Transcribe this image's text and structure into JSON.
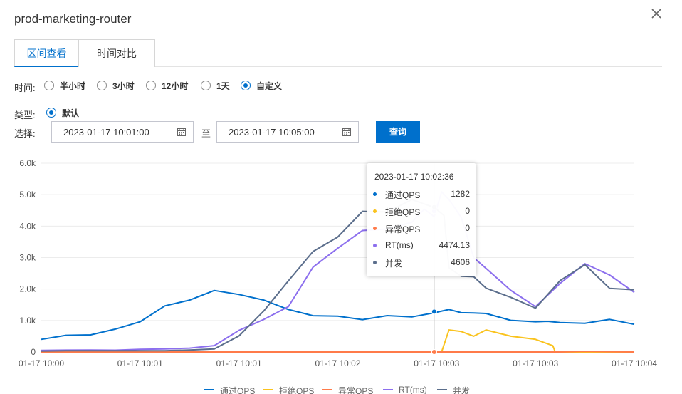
{
  "dialog": {
    "title": "prod-marketing-router"
  },
  "tabs": [
    {
      "label": "区间查看"
    },
    {
      "label": "时间对比"
    }
  ],
  "time_filter": {
    "label": "时间:",
    "options": [
      {
        "label": "半小时",
        "checked": false
      },
      {
        "label": "3小时",
        "checked": false
      },
      {
        "label": "12小时",
        "checked": false
      },
      {
        "label": "1天",
        "checked": false
      },
      {
        "label": "自定义",
        "checked": true
      }
    ]
  },
  "type_filter": {
    "label": "类型:",
    "options": [
      {
        "label": "默认",
        "checked": true
      }
    ]
  },
  "range": {
    "label": "选择:",
    "start": "2023-01-17 10:01:00",
    "separator": "至",
    "end": "2023-01-17 10:05:00",
    "query_label": "查询"
  },
  "tooltip": {
    "title": "2023-01-17 10:02:36",
    "rows": [
      {
        "name": "通过QPS",
        "value": "1282",
        "color": "#0070cc"
      },
      {
        "name": "拒绝QPS",
        "value": "0",
        "color": "#fac31e"
      },
      {
        "name": "异常QPS",
        "value": "0",
        "color": "#ff7b4a"
      },
      {
        "name": "RT(ms)",
        "value": "4474.13",
        "color": "#8c6fee"
      },
      {
        "name": "并发",
        "value": "4606",
        "color": "#5b6e8c"
      }
    ]
  },
  "chart_data": {
    "type": "line",
    "y_ticks": [
      "0",
      "1.0k",
      "2.0k",
      "3.0k",
      "4.0k",
      "5.0k",
      "6.0k"
    ],
    "x_ticks": [
      "01-17 10:00",
      "01-17 10:01",
      "01-17 10:01",
      "01-17 10:02",
      "01-17 10:03",
      "01-17 10:03",
      "01-17 10:04"
    ],
    "ylim": [
      0,
      6000
    ],
    "x_range": [
      0,
      240
    ],
    "hover_x": 159,
    "series": [
      {
        "name": "通过QPS",
        "color": "#0070cc",
        "x": [
          0,
          10,
          20,
          30,
          40,
          50,
          60,
          70,
          80,
          90,
          100,
          110,
          120,
          130,
          140,
          150,
          159,
          165,
          170,
          175,
          180,
          190,
          200,
          205,
          210,
          220,
          230,
          240
        ],
        "values": [
          400,
          520,
          560,
          700,
          1000,
          1420,
          1680,
          1950,
          1800,
          1700,
          1300,
          1200,
          1100,
          1050,
          1150,
          1100,
          1282,
          1300,
          1300,
          1200,
          1250,
          1000,
          950,
          1000,
          900,
          950,
          1000,
          900
        ]
      },
      {
        "name": "拒绝QPS",
        "color": "#fac31e",
        "x": [
          0,
          10,
          20,
          30,
          40,
          50,
          60,
          70,
          80,
          90,
          100,
          110,
          120,
          130,
          140,
          150,
          159,
          162,
          165,
          170,
          175,
          180,
          190,
          200,
          207,
          208,
          210,
          220,
          230,
          240
        ],
        "values": [
          0,
          0,
          0,
          0,
          0,
          0,
          0,
          0,
          0,
          0,
          0,
          0,
          0,
          0,
          0,
          0,
          0,
          0,
          700,
          650,
          500,
          700,
          500,
          400,
          200,
          0,
          0,
          0,
          0,
          0
        ]
      },
      {
        "name": "异常QPS",
        "color": "#ff7b4a",
        "x": [
          0,
          30,
          60,
          90,
          120,
          150,
          159,
          190,
          210,
          220,
          230,
          240
        ],
        "values": [
          0,
          0,
          0,
          0,
          0,
          0,
          0,
          0,
          0,
          20,
          10,
          0
        ]
      },
      {
        "name": "RT(ms)",
        "color": "#8c6fee",
        "x": [
          0,
          10,
          20,
          30,
          40,
          50,
          60,
          70,
          80,
          90,
          100,
          110,
          120,
          130,
          140,
          150,
          155,
          159,
          162,
          165,
          170,
          175,
          180,
          190,
          200,
          210,
          220,
          230,
          240
        ],
        "values": [
          50,
          60,
          60,
          60,
          80,
          100,
          120,
          200,
          700,
          1000,
          1500,
          2600,
          3400,
          3800,
          3900,
          4200,
          4400,
          4474,
          4900,
          5000,
          4200,
          3000,
          2700,
          1900,
          1500,
          2100,
          2900,
          2400,
          1900
        ]
      },
      {
        "name": "并发",
        "color": "#5b6e8c",
        "x": [
          0,
          10,
          20,
          30,
          40,
          50,
          60,
          70,
          80,
          90,
          100,
          110,
          120,
          130,
          140,
          150,
          159,
          163,
          165,
          170,
          175,
          180,
          190,
          200,
          210,
          220,
          230,
          240
        ],
        "values": [
          30,
          40,
          40,
          40,
          40,
          40,
          60,
          100,
          500,
          1300,
          2300,
          3100,
          3800,
          4300,
          4600,
          4750,
          4606,
          4400,
          2600,
          2500,
          2300,
          2100,
          1700,
          1400,
          2300,
          2700,
          2100,
          1900
        ]
      }
    ],
    "legend_placement": "bottom-center"
  }
}
